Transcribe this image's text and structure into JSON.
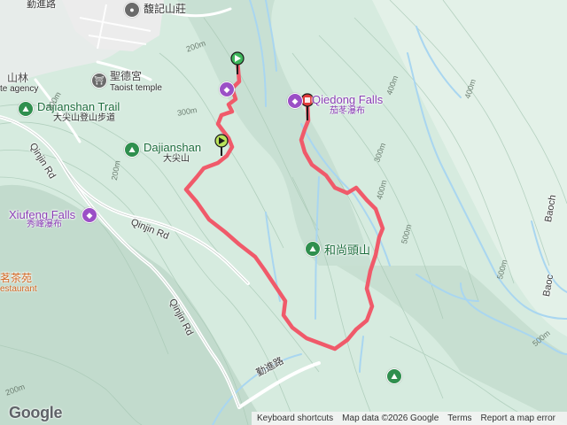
{
  "map": {
    "places": {
      "top_road": "勤進路",
      "fushan_villa": "馥記山莊",
      "taoist_temple": {
        "name": "聖德宮",
        "sub": "Taoist temple"
      },
      "left_edge_name": "山林",
      "left_edge_sub": "te agency",
      "dajianshan_trail": {
        "name": "Dajianshan Trail",
        "sub": "大尖山登山步道"
      },
      "dajianshan": {
        "name": "Dajianshan",
        "sub": "大尖山"
      },
      "qiedong_falls": {
        "name": "Qiedong Falls",
        "sub": "茄苳瀑布"
      },
      "xiufeng_falls": {
        "name": "Xiufeng Falls",
        "sub": "秀峰瀑布"
      },
      "heshangtou": "和尚頭山",
      "restaurant": {
        "name": "茗茶苑",
        "sub": "estaurant"
      },
      "baoch_1": "Baoch",
      "baoch_2": "Baoc"
    },
    "roads": {
      "qinjin_1": "Qinjin Rd",
      "qinjin_2": "Qinjin Rd",
      "qinjin_3": "Qinjin Rd",
      "bottom_road": "勤進路"
    },
    "elevations": [
      "200m",
      "300m",
      "300m",
      "400m",
      "400m",
      "200m",
      "300m",
      "400m",
      "500m",
      "500m",
      "500m",
      "200m"
    ],
    "attribution": {
      "keyboard": "Keyboard shortcuts",
      "map_data": "Map data ©2026 Google",
      "terms": "Terms",
      "report": "Report a map error"
    },
    "logo": "Google",
    "colors": {
      "track": "#f05a6a",
      "water": "#a9d6f0",
      "terrain": "#d2e9dc",
      "green_poi": "#1e6e3e",
      "purple_poi": "#8a3fb5"
    }
  }
}
